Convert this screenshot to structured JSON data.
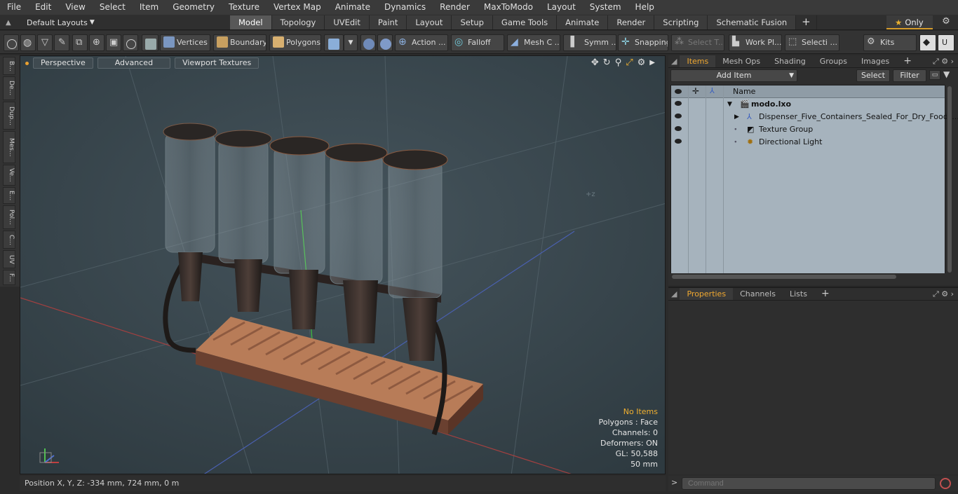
{
  "menu": [
    "File",
    "Edit",
    "View",
    "Select",
    "Item",
    "Geometry",
    "Texture",
    "Vertex Map",
    "Animate",
    "Dynamics",
    "Render",
    "MaxToModo",
    "Layout",
    "System",
    "Help"
  ],
  "layout": {
    "label": "Default Layouts",
    "tabs": [
      "Model",
      "Topology",
      "UVEdit",
      "Paint",
      "Layout",
      "Setup",
      "Game Tools",
      "Animate",
      "Render",
      "Scripting",
      "Schematic Fusion"
    ],
    "active_tab": "Model",
    "only_label": "Only"
  },
  "toolbar": {
    "vertices": "Vertices",
    "boundary": "Boundary",
    "polygons": "Polygons",
    "action": "Action ...",
    "falloff": "Falloff",
    "mesh": "Mesh C ...",
    "symm": "Symm ...",
    "snapping": "Snapping",
    "select_t": "Select T...",
    "work_pl": "Work Pl...",
    "selecti": "Selecti ...",
    "kits": "Kits"
  },
  "left_strip": [
    "B...",
    "De...",
    "Dup...",
    "Mes...",
    "Ve...",
    "E...",
    "Pol...",
    "C...",
    "UV",
    "F..."
  ],
  "viewport": {
    "perspective": "Perspective",
    "advanced": "Advanced",
    "textures": "Viewport Textures",
    "info": {
      "selection": "No Items",
      "polygons": "Polygons : Face",
      "channels": "Channels: 0",
      "deformers": "Deformers: ON",
      "gl": "GL: 50,588",
      "size": "50 mm"
    }
  },
  "status": {
    "position": "Position X, Y, Z:  -334 mm, 724 mm, 0 m"
  },
  "items_panel": {
    "tabs": [
      "Items",
      "Mesh Ops",
      "Shading",
      "Groups",
      "Images"
    ],
    "add_item": "Add Item",
    "select": "Select",
    "filter": "Filter",
    "col_name": "Name",
    "rows": [
      {
        "label": "modo.lxo"
      },
      {
        "label": "Dispenser_Five_Containers_Sealed_For_Dry_Food_..."
      },
      {
        "label": "Texture Group"
      },
      {
        "label": "Directional Light"
      }
    ]
  },
  "props_panel": {
    "tabs": [
      "Properties",
      "Channels",
      "Lists"
    ]
  },
  "command": {
    "placeholder": "Command"
  },
  "colors": {
    "accent": "#f0a830",
    "viewport_bg": "#3b4a52",
    "list_bg": "#a6b3bd"
  }
}
